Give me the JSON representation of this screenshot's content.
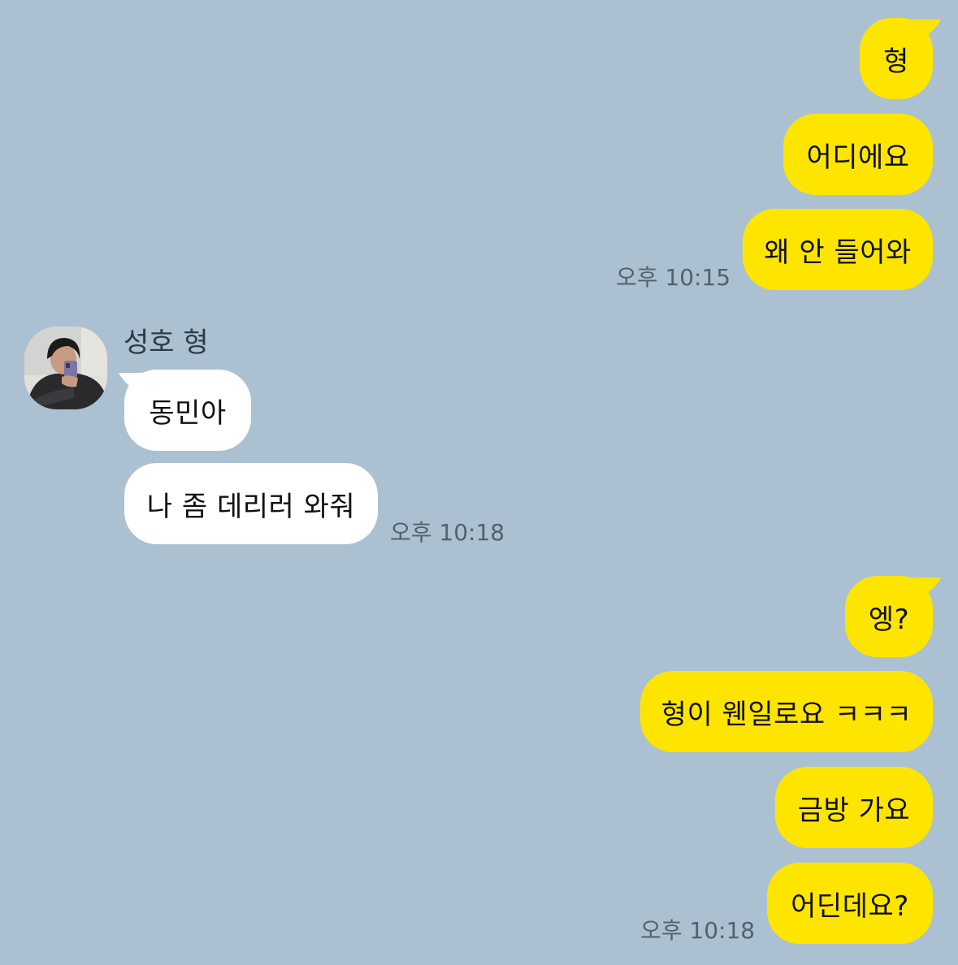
{
  "colors": {
    "background": "#abc1d2",
    "my_bubble": "#fee500",
    "their_bubble": "#ffffff",
    "timestamp": "#55606b"
  },
  "messages": {
    "m1": "형",
    "m2": "어디에요",
    "m3": "왜 안 들어와",
    "t1": "오후 10:15",
    "sender": "성호 형",
    "avatar_icon": "profile-photo-icon",
    "r1": "동민아",
    "r2": "나 좀 데리러 와줘",
    "t2": "오후 10:18",
    "m4": "엥?",
    "m5": "형이 웬일로요 ㅋㅋㅋ",
    "m6": "금방 가요",
    "m7": "어딘데요?",
    "t3": "오후 10:18"
  }
}
